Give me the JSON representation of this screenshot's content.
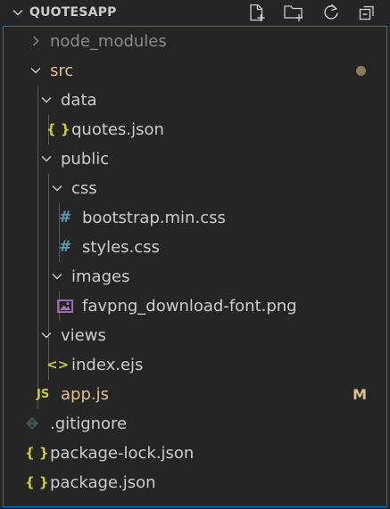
{
  "explorer": {
    "title": "QUOTESAPP",
    "actions": [
      "new-file",
      "new-folder",
      "refresh",
      "collapse-all"
    ]
  },
  "tree": [
    {
      "label": "node_modules",
      "kind": "folder",
      "expanded": false,
      "color": "#8b8b8b"
    },
    {
      "label": "src",
      "kind": "folder",
      "expanded": true,
      "color": "#e2c08d",
      "status": "modified-dot"
    },
    {
      "label": "data",
      "kind": "folder",
      "expanded": true,
      "color": "#cccccc"
    },
    {
      "label": "quotes.json",
      "kind": "file",
      "icon": "json-icon",
      "icon_text": "{ }",
      "color": "#cccccc"
    },
    {
      "label": "public",
      "kind": "folder",
      "expanded": true,
      "color": "#cccccc"
    },
    {
      "label": "css",
      "kind": "folder",
      "expanded": true,
      "color": "#cccccc"
    },
    {
      "label": "bootstrap.min.css",
      "kind": "file",
      "icon": "css-icon",
      "icon_text": "#",
      "color": "#cccccc"
    },
    {
      "label": "styles.css",
      "kind": "file",
      "icon": "css-icon",
      "icon_text": "#",
      "color": "#cccccc"
    },
    {
      "label": "images",
      "kind": "folder",
      "expanded": true,
      "color": "#cccccc"
    },
    {
      "label": "favpng_download-font.png",
      "kind": "file",
      "icon": "image-icon",
      "color": "#cccccc"
    },
    {
      "label": "views",
      "kind": "folder",
      "expanded": true,
      "color": "#cccccc"
    },
    {
      "label": "index.ejs",
      "kind": "file",
      "icon": "code-icon",
      "icon_text": "<>",
      "color": "#cccccc"
    },
    {
      "label": "app.js",
      "kind": "file",
      "icon": "js-icon",
      "icon_text": "JS",
      "color": "#e2c08d",
      "badge": "M"
    },
    {
      "label": ".gitignore",
      "kind": "file",
      "icon": "git-icon",
      "color": "#cccccc"
    },
    {
      "label": "package-lock.json",
      "kind": "file",
      "icon": "json-icon",
      "icon_text": "{ }",
      "color": "#cccccc"
    },
    {
      "label": "package.json",
      "kind": "file",
      "icon": "json-icon",
      "icon_text": "{ }",
      "color": "#cccccc"
    }
  ],
  "colors": {
    "background": "#252526",
    "focus_border": "#007fd4",
    "modified": "#e2c08d",
    "json_icon": "#cbcb41",
    "css_icon": "#519aba",
    "image_icon": "#a074c4",
    "js_icon": "#cbcb41"
  }
}
